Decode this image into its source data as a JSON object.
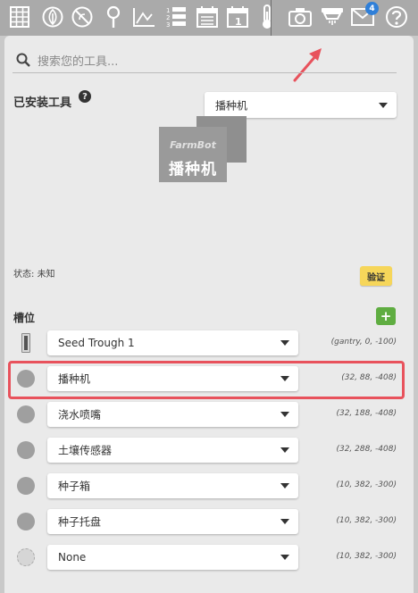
{
  "nav": {
    "icons": [
      "grid-icon",
      "leaf-icon",
      "no-weeds-icon",
      "map-point-icon",
      "chart-icon",
      "sequences-icon",
      "regimens-icon",
      "calendar-icon",
      "thermometer-icon",
      "camera-icon",
      "tools-icon",
      "messages-icon",
      "help-icon"
    ],
    "messages_badge": "4",
    "calendar_day": "1"
  },
  "search": {
    "placeholder": "搜索您的工具..."
  },
  "installed_tool": {
    "title": "已安装工具",
    "help_symbol": "?",
    "selected": "播种机",
    "image_brand": "FarmBot",
    "image_label": "播种机",
    "status_label": "状态:",
    "status_value": "未知",
    "verify_label": "验证"
  },
  "slots": {
    "title": "槽位",
    "add_symbol": "+",
    "rows": [
      {
        "tool": "Seed Trough 1",
        "coords": "(gantry, 0, -100)",
        "icon": "trough"
      },
      {
        "tool": "播种机",
        "coords": "(32, 88, -408)",
        "icon": "filled"
      },
      {
        "tool": "浇水喷嘴",
        "coords": "(32, 188, -408)",
        "icon": "filled"
      },
      {
        "tool": "土壤传感器",
        "coords": "(32, 288, -408)",
        "icon": "filled"
      },
      {
        "tool": "种子箱",
        "coords": "(10, 382, -300)",
        "icon": "filled"
      },
      {
        "tool": "种子托盘",
        "coords": "(10, 382, -300)",
        "icon": "filled"
      },
      {
        "tool": "None",
        "coords": "(10, 382, -300)",
        "icon": "empty"
      }
    ]
  },
  "colors": {
    "highlight": "#e8525c",
    "verify": "#f6d65a",
    "add": "#5fad41",
    "badge": "#2f7fd8"
  }
}
